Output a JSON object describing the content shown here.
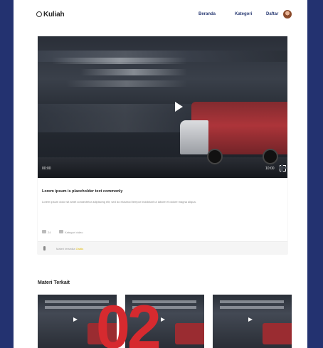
{
  "header": {
    "logo_text": "Kuliah",
    "nav": [
      "Beranda",
      "Kategori",
      "Daftar"
    ]
  },
  "video": {
    "time_current": "00:00",
    "time_total": "10:00",
    "title": "Lorem ipsum is placeholder text commonly",
    "description": "Lorem ipsum dolor sit amet consectetur adipiscing elit, sed do eiusmod tempor incididunt ut labore et dolore magna aliqua.",
    "likes": "24",
    "category_label": "Kategori video",
    "footer_text": "Materi tersedia",
    "footer_highlight": "Gratis"
  },
  "related": {
    "title": "Materi Terkait",
    "overlay_number": "02"
  },
  "colors": {
    "frame": "#233270",
    "nav_link": "#2c3d75",
    "accent_red": "#d62a2f",
    "highlight": "#e0b800"
  }
}
